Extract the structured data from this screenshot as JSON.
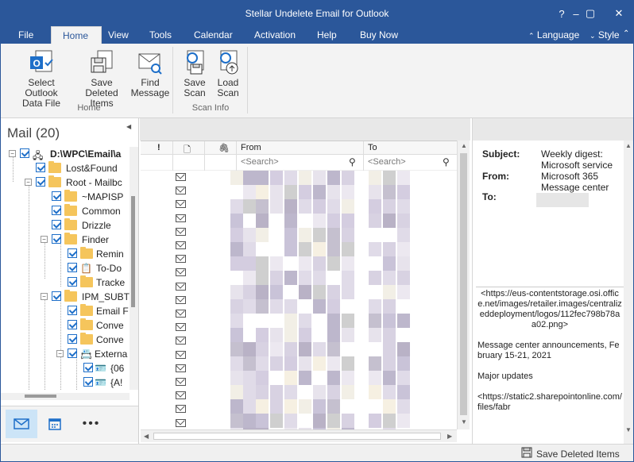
{
  "window": {
    "title": "Stellar Undelete Email for Outlook",
    "controls": [
      "?",
      "–",
      "▢",
      "✕"
    ]
  },
  "menu": {
    "items": [
      "File",
      "Home",
      "View",
      "Tools",
      "Calendar",
      "Activation",
      "Help",
      "Buy Now"
    ],
    "active": "Home",
    "language": "Language",
    "style": "Style"
  },
  "ribbon": {
    "home_group": "Home",
    "scan_group": "Scan Info",
    "buttons": [
      {
        "label1": "Select Outlook",
        "label2": "Data File",
        "icon": "outlook-file-icon"
      },
      {
        "label1": "Save Deleted",
        "label2": "Items",
        "icon": "save-icon"
      },
      {
        "label1": "Find",
        "label2": "Message",
        "icon": "find-message-icon"
      },
      {
        "label1": "Save",
        "label2": "Scan",
        "icon": "save-scan-icon"
      },
      {
        "label1": "Load",
        "label2": "Scan",
        "icon": "load-scan-icon"
      }
    ]
  },
  "left_pane": {
    "title": "Mail (20)",
    "tree": [
      {
        "label": "D:\\WPC\\Email\\a",
        "bold": true
      },
      {
        "label": "Lost&Found"
      },
      {
        "label": "Root - Mailbc"
      },
      {
        "label": "~MAPISP"
      },
      {
        "label": "Common"
      },
      {
        "label": "Drizzle"
      },
      {
        "label": "Finder"
      },
      {
        "label": "Remin"
      },
      {
        "label": "To-Do"
      },
      {
        "label": "Tracke"
      },
      {
        "label": "IPM_SUBT"
      },
      {
        "label": "Email F"
      },
      {
        "label": "Conve"
      },
      {
        "label": "Conve"
      },
      {
        "label": "Externa"
      },
      {
        "label": "{06"
      },
      {
        "label": "{A!"
      }
    ]
  },
  "mail_list": {
    "col_flag": "!",
    "col_type": "🗋",
    "col_attach": "🖇",
    "col_from": "From",
    "col_to": "To",
    "search_placeholder_from": "<Search>",
    "search_placeholder_to": "<Search>",
    "row_count": 20
  },
  "preview": {
    "subject_label": "Subject:",
    "subject_value": "Weekly digest: Microsoft service",
    "from_label": "From:",
    "from_value": "Microsoft 365 Message center",
    "to_label": "To:",
    "body_lines": [
      "<https://eus-contentstorage.osi.office.net/images/retailer.images/centralizeddeployment/logos/112fec798b78aa02.png>",
      "",
      "Message center announcements, February 15-21, 2021",
      "",
      "Major updates",
      "",
      "<https://static2.sharepointonline.com/files/fabr"
    ]
  },
  "status_bar": {
    "save_label": "Save Deleted Items"
  },
  "colors": {
    "accent": "#2b579a",
    "ribbon_bg": "#f3f3f3",
    "check": "#1e6fc9",
    "folder": "#f5c55c"
  }
}
